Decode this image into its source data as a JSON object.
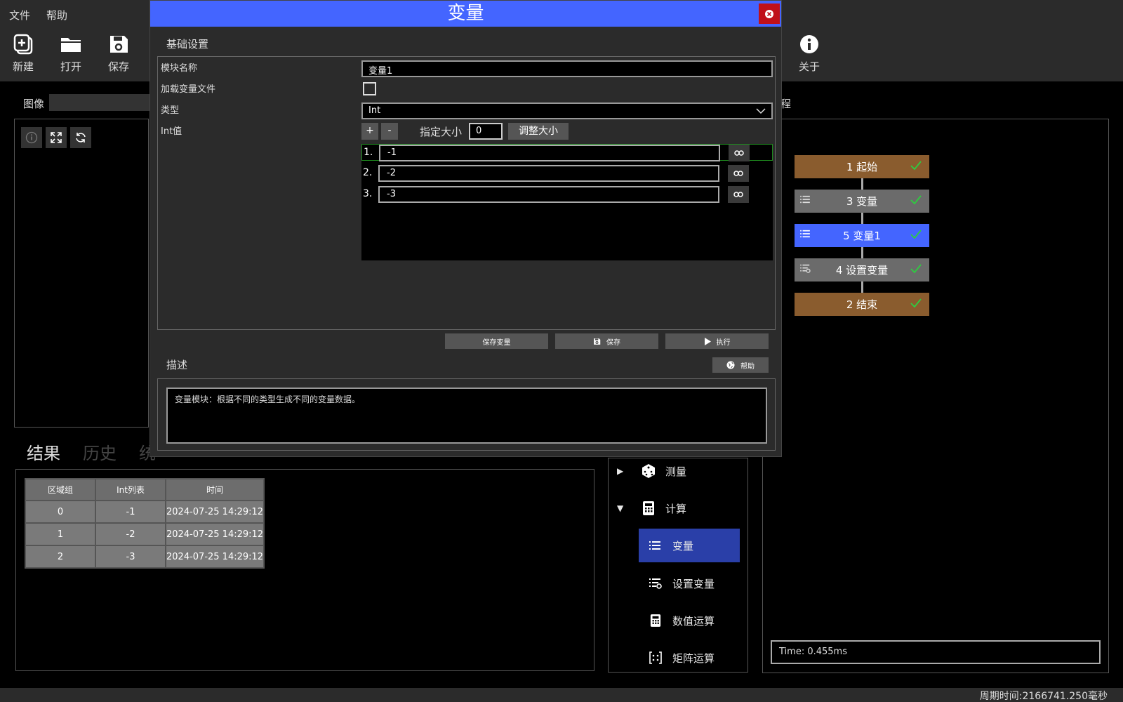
{
  "menu": {
    "file": "文件",
    "help": "帮助"
  },
  "toolbar": {
    "new": "新建",
    "open": "打开",
    "save": "保存",
    "about": "关于"
  },
  "image_panel": {
    "label": "图像"
  },
  "results": {
    "tabs": [
      "结果",
      "历史",
      "统"
    ],
    "columns": [
      "区域组",
      "Int列表",
      "时间"
    ],
    "rows": [
      [
        "0",
        "-1",
        "2024-07-25 14:29:12"
      ],
      [
        "1",
        "-2",
        "2024-07-25 14:29:12"
      ],
      [
        "2",
        "-3",
        "2024-07-25 14:29:12"
      ]
    ]
  },
  "tree": {
    "measure": "测量",
    "compute": "计算",
    "variable": "变量",
    "set_variable": "设置变量",
    "numeric_op": "数值运算",
    "matrix_op": "矩阵运算"
  },
  "flow": {
    "label": "程",
    "nodes": [
      {
        "label": "1 起始",
        "color": "#8a5c2e"
      },
      {
        "label": "3 变量",
        "color": "#6b6b6b"
      },
      {
        "label": "5 变量1",
        "color": "#4465ff"
      },
      {
        "label": "4 设置变量",
        "color": "#6b6b6b"
      },
      {
        "label": "2 结束",
        "color": "#8a5c2e"
      }
    ],
    "time": "Time: 0.455ms"
  },
  "status": {
    "cycle_time": "周期时间:2166741.250毫秒"
  },
  "dialog": {
    "title": "变量",
    "basic_settings": "基础设置",
    "module_name_label": "模块名称",
    "module_name_value": "变量1",
    "load_file_label": "加载变量文件",
    "type_label": "类型",
    "type_value": "Int",
    "int_values_label": "Int值",
    "plus": "+",
    "minus": "-",
    "size_label": "指定大小",
    "size_value": "0",
    "resize_button": "调整大小",
    "values": [
      {
        "num": "1.",
        "value": "-1"
      },
      {
        "num": "2.",
        "value": "-2"
      },
      {
        "num": "3.",
        "value": "-3"
      }
    ],
    "save_var_button": "保存变量",
    "save_button": "保存",
    "run_button": "执行",
    "description_title": "描述",
    "help_button": "帮助",
    "description_text": "变量模块：根据不同的类型生成不同的变量数据。"
  },
  "colors": {
    "accent": "#4465ff",
    "selection": "#2a3fa8",
    "close": "#c0101a",
    "check": "#2ecc40"
  }
}
